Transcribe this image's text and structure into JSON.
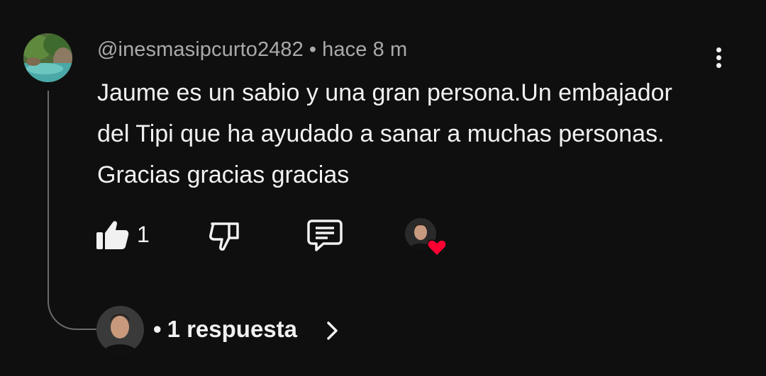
{
  "comment": {
    "author": "@inesmasipcurto2482",
    "separator": "•",
    "time": "hace 8 m",
    "text": "Jaume es un sabio y una gran persona.Un embajador del Tipi que ha ayudado a sanar a muchas personas. Gracias gracias gracias",
    "like_count": "1",
    "creator_heart": true
  },
  "icons": {
    "like": "thumbs-up-icon",
    "dislike": "thumbs-down-icon",
    "reply": "comment-icon",
    "menu": "more-vert-icon",
    "heart": "heart-icon",
    "chevron": "chevron-right-icon"
  },
  "replies": {
    "separator": "•",
    "label": "1 respuesta"
  },
  "colors": {
    "background": "#0f0f0f",
    "text": "#f1f1f1",
    "meta": "#aaaaaa",
    "heart": "#ff0033",
    "thread_line": "#6a6a6a"
  }
}
